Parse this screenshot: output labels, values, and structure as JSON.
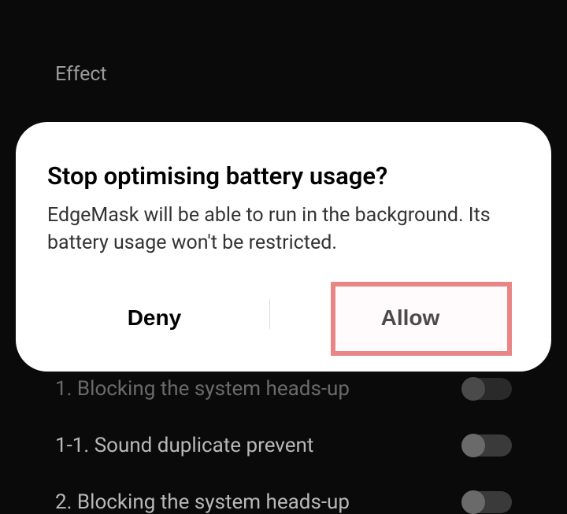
{
  "background": {
    "header": "Effect",
    "settings": [
      {
        "label": "1. Blocking the system heads-up",
        "dim": true
      },
      {
        "label": "1-1. Sound duplicate prevent",
        "dim": false
      },
      {
        "label": "2. Blocking the system heads-up",
        "dim": false
      }
    ]
  },
  "dialog": {
    "title": "Stop optimising battery usage?",
    "body": "EdgeMask will be able to run in the background. Its battery usage won't be restricted.",
    "deny_label": "Deny",
    "allow_label": "Allow"
  }
}
